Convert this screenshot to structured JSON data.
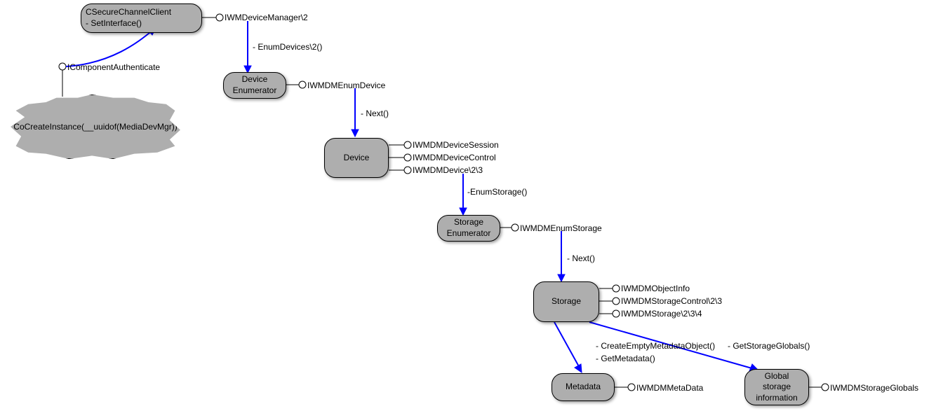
{
  "nodes": {
    "secure_channel": {
      "line1": "CSecureChannelClient",
      "line2": "- SetInterface()"
    },
    "cloud": "CoCreateInstance(__uuidof(MediaDevMgr))",
    "device_enum": {
      "line1": "Device",
      "line2": "Enumerator"
    },
    "device": "Device",
    "storage_enum": {
      "line1": "Storage",
      "line2": "Enumerator"
    },
    "storage": "Storage",
    "metadata": "Metadata",
    "global_storage": {
      "line1": "Global",
      "line2": "storage",
      "line3": "information"
    }
  },
  "interfaces": {
    "iwm_device_manager": "IWMDeviceManager\\2",
    "icomponent_auth": "IComponentAuthenticate",
    "iwmdm_enum_device": "IWMDMEnumDevice",
    "iwmdm_device_session": "IWMDMDeviceSession",
    "iwmdm_device_control": "IWMDMDeviceControl",
    "iwmdm_device": "IWMDMDevice\\2\\3",
    "iwmdm_enum_storage": "IWMDMEnumStorage",
    "iwmdm_object_info": "IWMDMObjectInfo",
    "iwmdm_storage_control": "IWMDMStorageControl\\2\\3",
    "iwmdm_storage": "IWMDMStorage\\2\\3\\4",
    "iwmdm_metadata": "IWMDMMetaData",
    "iwmdm_storage_globals": "IWMDMStorageGlobals"
  },
  "methods": {
    "enum_devices": "- EnumDevices\\2()",
    "next1": "- Next()",
    "enum_storage": "-EnumStorage()",
    "next2": "- Next()",
    "create_empty_metadata": "- CreateEmptyMetadataObject()",
    "get_metadata": "- GetMetadata()",
    "get_storage_globals": "- GetStorageGlobals()"
  }
}
